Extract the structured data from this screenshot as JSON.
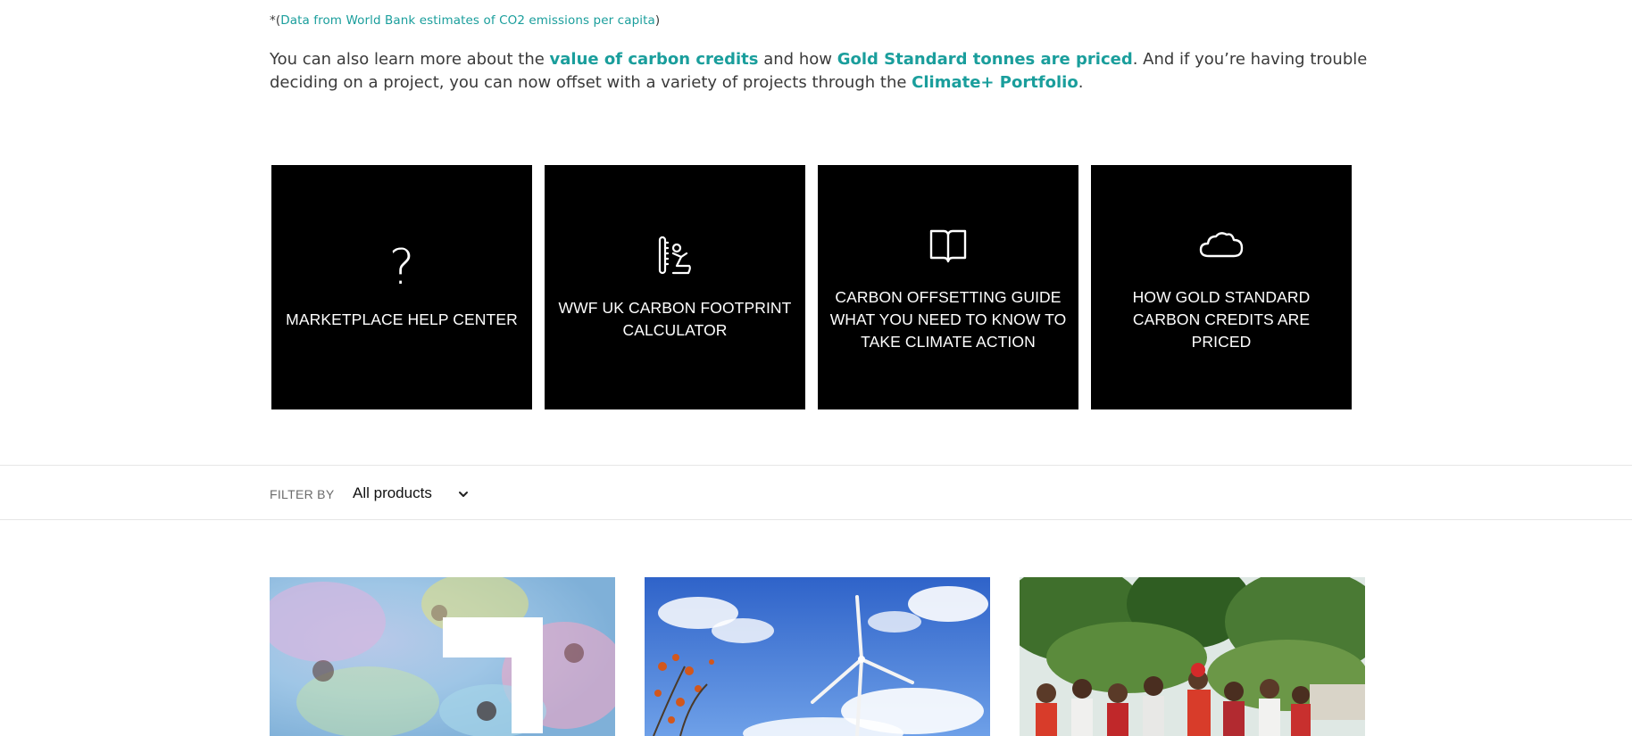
{
  "footnote": {
    "prefix": "*(",
    "link": "Data from World Bank estimates of CO2 emissions per capita",
    "suffix": ")"
  },
  "intro": {
    "t1": "You can also learn more about the ",
    "link1": "value of carbon credits",
    "t2": " and how ",
    "link2": "Gold Standard tonnes are priced",
    "t3": ". And if you’re having trouble deciding on a project, you can now offset with a variety of projects through the ",
    "link3": "Climate+ Portfolio",
    "t4": "."
  },
  "cards": [
    {
      "label": "MARKETPLACE HELP CENTER",
      "icon": "question-mark-icon"
    },
    {
      "label": "WWF UK CARBON FOOTPRINT CALCULATOR",
      "icon": "thermometer-person-icon"
    },
    {
      "label": "CARBON OFFSETTING GUIDE WHAT YOU NEED TO KNOW TO TAKE CLIMATE ACTION",
      "icon": "open-book-icon"
    },
    {
      "label": "HOW GOLD STANDARD CARBON CREDITS ARE PRICED",
      "icon": "cloud-icon"
    }
  ],
  "filter": {
    "label": "FILTER BY",
    "selected": "All products"
  },
  "colors": {
    "accent": "#1a9e9c",
    "card_bg": "#000000",
    "text": "#3a3a3a"
  }
}
